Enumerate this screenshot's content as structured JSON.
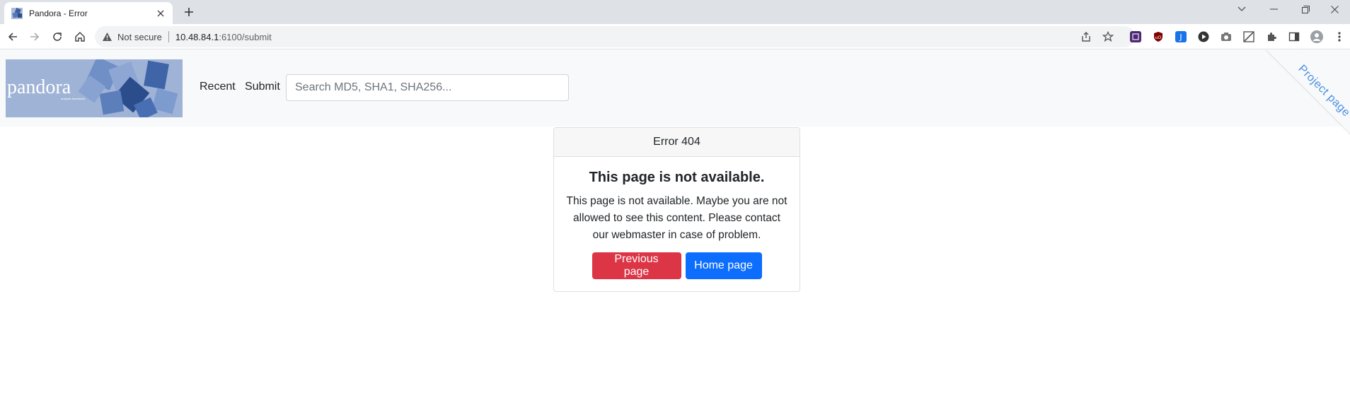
{
  "browser": {
    "tab_title": "Pandora - Error",
    "omnibox": {
      "security_label": "Not secure",
      "url_host": "10.48.84.1",
      "url_path": ":6100/submit"
    }
  },
  "navbar": {
    "logo_text": "pandora",
    "logo_subtext": "analysis framework",
    "links": [
      "Recent",
      "Submit"
    ],
    "search_placeholder": "Search MD5, SHA1, SHA256...",
    "ribbon_label": "Project page"
  },
  "error_card": {
    "header": "Error 404",
    "title": "This page is not available.",
    "message": "This page is not available. Maybe you are not allowed to see this content. Please contact our webmaster in case of problem.",
    "previous_button": "Previous page",
    "home_button": "Home page"
  },
  "colors": {
    "danger": "#dc3545",
    "primary": "#0d6efd",
    "ribbon_text": "#4a90e2",
    "navbar_bg": "#f8f9fa"
  }
}
